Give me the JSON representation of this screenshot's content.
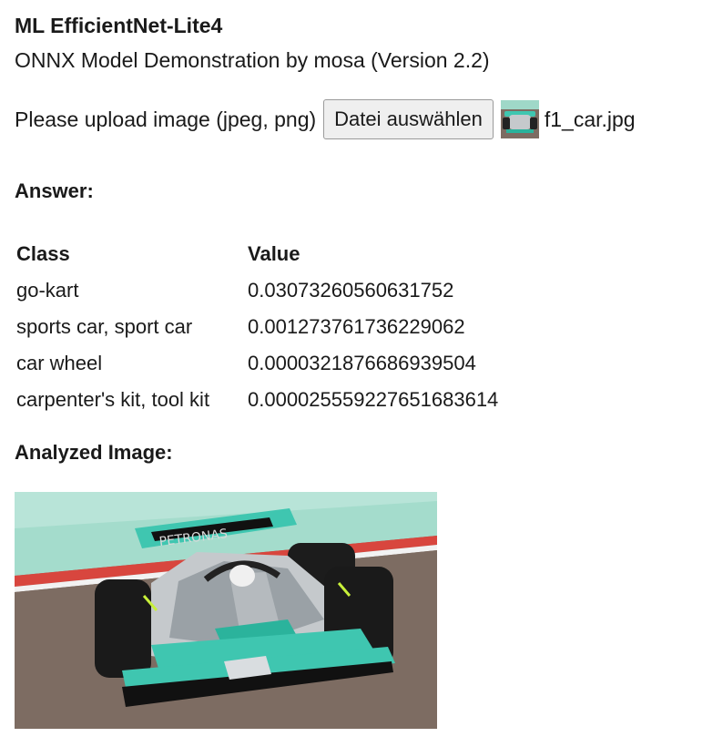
{
  "app": {
    "title": "ML EfficientNet-Lite4",
    "subtitle": "ONNX Model Demonstration by mosa (Version 2.2)"
  },
  "upload": {
    "label": "Please upload image (jpeg, png)",
    "button_label": "Datei auswählen",
    "file_name": "f1_car.jpg"
  },
  "answer": {
    "heading": "Answer:",
    "columns": [
      "Class",
      "Value"
    ],
    "rows": [
      {
        "class": "go-kart",
        "value": "0.03073260560631752"
      },
      {
        "class": "sports car, sport car",
        "value": "0.001273761736229062"
      },
      {
        "class": "car wheel",
        "value": "0.0000321876686939504"
      },
      {
        "class": "carpenter's kit, tool kit",
        "value": "0.000025559227651683614"
      }
    ]
  },
  "analyzed": {
    "heading": "Analyzed Image:"
  },
  "colors": {
    "text": "#1a1a1a",
    "button_bg": "#efefef",
    "car_teal": "#3fc6b0",
    "car_silver": "#c5c9cc",
    "track": "#7d6c62",
    "grass": "#9fd8c8"
  }
}
